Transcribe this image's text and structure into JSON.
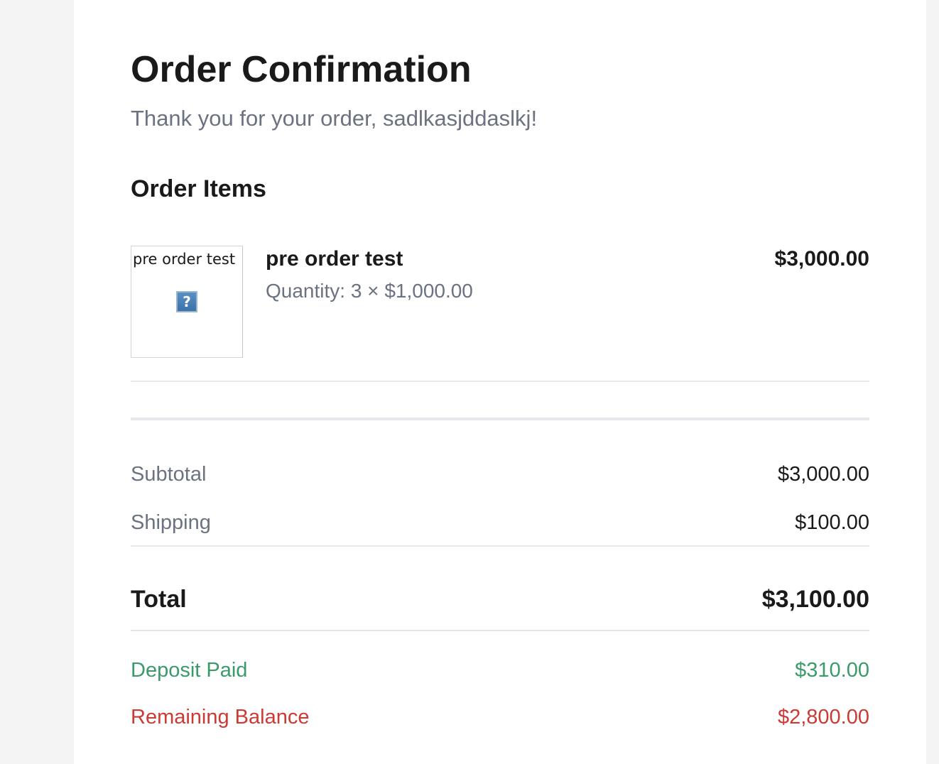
{
  "page": {
    "title": "Order Confirmation",
    "thank_you": "Thank you for your order, sadlkasjddaslkj!"
  },
  "items_section": {
    "title": "Order Items",
    "items": [
      {
        "image_alt": "pre order test",
        "image_icon": "broken-image-icon",
        "name": "pre order test",
        "quantity_line": "Quantity: 3 × $1,000.00",
        "line_total": "$3,000.00"
      }
    ]
  },
  "summary": {
    "subtotal_label": "Subtotal",
    "subtotal_value": "$3,000.00",
    "shipping_label": "Shipping",
    "shipping_value": "$100.00",
    "total_label": "Total",
    "total_value": "$3,100.00",
    "deposit_label": "Deposit Paid",
    "deposit_value": "$310.00",
    "remaining_label": "Remaining Balance",
    "remaining_value": "$2,800.00"
  },
  "colors": {
    "background": "#f4f4f5",
    "card": "#ffffff",
    "text": "#1a1a1a",
    "muted": "#6b7280",
    "divider": "#e5e7eb",
    "deposit": "#3a9a6a",
    "remaining": "#cc3a34"
  }
}
